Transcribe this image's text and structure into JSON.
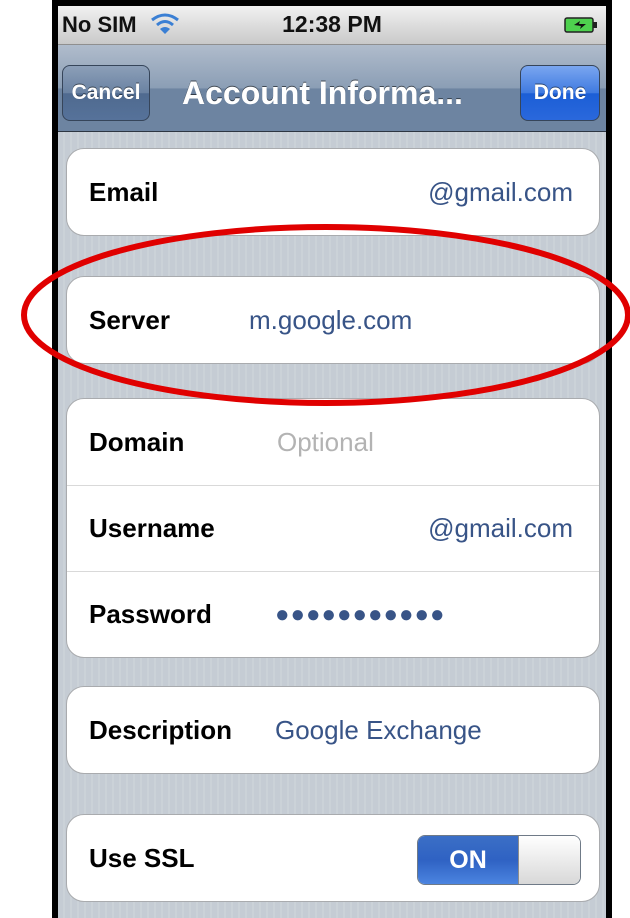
{
  "status_bar": {
    "carrier": "No SIM",
    "time": "12:38 PM",
    "wifi_icon": "wifi-icon",
    "battery_icon": "battery-charging-icon"
  },
  "nav": {
    "cancel_label": "Cancel",
    "title": "Account Informa...",
    "done_label": "Done"
  },
  "fields": {
    "email": {
      "label": "Email",
      "value": "@gmail.com"
    },
    "server": {
      "label": "Server",
      "value": "m.google.com"
    },
    "domain": {
      "label": "Domain",
      "placeholder": "Optional"
    },
    "username": {
      "label": "Username",
      "value": "@gmail.com"
    },
    "password": {
      "label": "Password",
      "value": "●●●●●●●●●●●"
    },
    "description": {
      "label": "Description",
      "value": "Google Exchange"
    },
    "use_ssl": {
      "label": "Use SSL",
      "toggle_label": "ON",
      "enabled": true
    }
  },
  "colors": {
    "value_text": "#385487",
    "nav_bar": "#6d84a1",
    "done_button": "#2a68dc",
    "highlight": "#e00000"
  }
}
